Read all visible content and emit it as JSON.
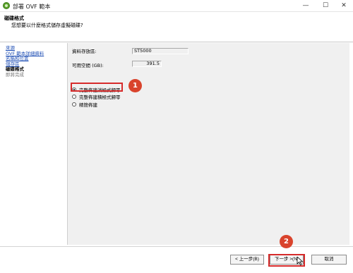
{
  "window": {
    "title": "部署 OVF 範本",
    "app_icon": "vsphere-client-icon",
    "controls": [
      "—",
      "☐",
      "✕"
    ]
  },
  "header": {
    "title": "磁碟格式",
    "subtitle": "您想要以什麼格式儲存虛擬磁碟?"
  },
  "nav": {
    "items": [
      {
        "label": "來源",
        "state": "link"
      },
      {
        "label": "OVF 範本詳細資料",
        "state": "link"
      },
      {
        "label": "名稱和位置",
        "state": "link"
      },
      {
        "label": "儲存區",
        "state": "link"
      },
      {
        "label": "磁碟格式",
        "state": "current"
      },
      {
        "label": "即將完成",
        "state": "disabled"
      }
    ]
  },
  "form": {
    "datastore_label": "資料存放區:",
    "datastore_value": "ST5000",
    "free_space_label": "可用空間 (GB):",
    "free_space_value": "391.5",
    "options": [
      {
        "label": "完整佈建消極式歸零",
        "selected": true
      },
      {
        "label": "完整佈建積極式歸零",
        "selected": false
      },
      {
        "label": "精簡佈建",
        "selected": false
      }
    ]
  },
  "annotations": {
    "badge1": "1",
    "badge2": "2",
    "highlight_color": "#d62b2b",
    "badge_color": "#d9432c"
  },
  "footer": {
    "back_label": "< 上一步(B)",
    "next_label": "下一步 >(N)",
    "cancel_label": "取消"
  }
}
